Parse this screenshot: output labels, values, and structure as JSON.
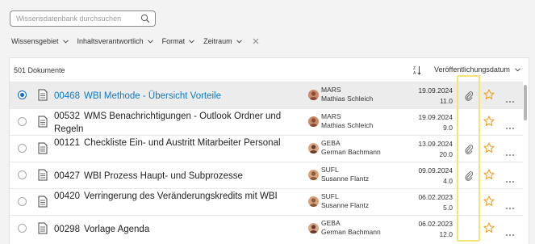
{
  "search": {
    "placeholder": "Wissensdatenbank durchsuchen",
    "icon": "search-icon"
  },
  "filters": [
    {
      "label": "Wissensgebiet"
    },
    {
      "label": "Inhaltsverantwortlich"
    },
    {
      "label": "Format"
    },
    {
      "label": "Zeitraum"
    }
  ],
  "list": {
    "count_label": "501 Dokumente",
    "sort_label": "Veröffentlichungsdatum",
    "rows": [
      {
        "id": "00468",
        "title": "WBI Methode - Übersicht Vorteile",
        "org": "MARS",
        "person": "Mathias Schleich",
        "date": "19.09.2024",
        "version": "11.0",
        "attachment": true,
        "selected": true
      },
      {
        "id": "00532",
        "title": "WMS Benachrichtigungen - Outlook Ordner und Regeln",
        "org": "MARS",
        "person": "Mathias Schleich",
        "date": "19.09.2024",
        "version": "9.0",
        "attachment": false,
        "selected": false
      },
      {
        "id": "00121",
        "title": "Checkliste Ein- und Austritt Mitarbeiter Personal",
        "org": "GEBA",
        "person": "German Bachmann",
        "date": "13.09.2024",
        "version": "20.0",
        "attachment": true,
        "selected": false
      },
      {
        "id": "00427",
        "title": "WBI Prozess Haupt- und Subprozesse",
        "org": "SUFL",
        "person": "Susanne Flantz",
        "date": "09.09.2024",
        "version": "4.0",
        "attachment": true,
        "selected": false
      },
      {
        "id": "00420",
        "title": "Verringerung des Veränderungskredits mit WBI",
        "org": "SUFL",
        "person": "Susanne Flantz",
        "date": "06.02.2023",
        "version": "5.0",
        "attachment": false,
        "selected": false
      },
      {
        "id": "00298",
        "title": "Vorlage Agenda",
        "org": "GEBA",
        "person": "German Bachmann",
        "date": "06.02.2023",
        "version": "12.0",
        "attachment": false,
        "selected": false
      }
    ]
  },
  "colors": {
    "accent": "#0f78c8",
    "star": "#f0a020",
    "highlight": "#f5e37a"
  }
}
